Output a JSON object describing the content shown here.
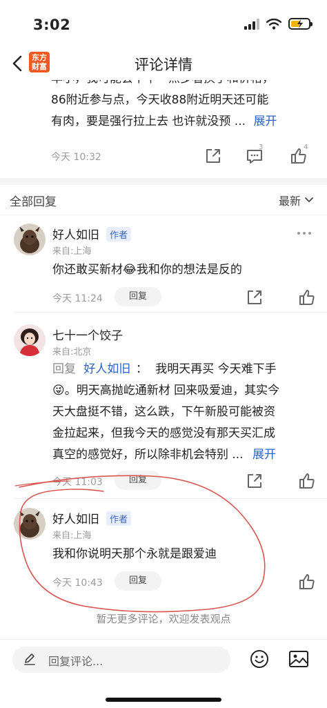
{
  "status_bar": {
    "time": "3:02"
  },
  "nav": {
    "title": "评论详情",
    "logo_line1": "东方",
    "logo_line2": "财富"
  },
  "main_comment": {
    "text_line1": "率小，我可能会下午一点多看换手和价格，",
    "text_line2": "86附近参与点，今天收88附近明天还可能",
    "text_line3": "有肉，要是强行拉上去 也许就没预 ...",
    "expand": "展开",
    "time": "今天 10:32",
    "comment_count": "3",
    "like_count": "4"
  },
  "replies_header": {
    "title": "全部回复",
    "sort": "最新"
  },
  "replies": [
    {
      "username": "好人如旧",
      "badge": "作者",
      "location": "来自:上海",
      "text": "你还敢买新材😂我和你的想法是反的",
      "time": "今天 11:24",
      "reply_label": "回复"
    },
    {
      "username": "七十一个饺子",
      "location": "来自:北京",
      "reply_prefix": "回复",
      "reply_to": "好人如旧",
      "reply_colon": "：",
      "text_line1": "我明天再买  今天难下手",
      "text_line2": "😜。明天高抛屹通新材 回来吸爱迪，其实今",
      "text_line3": "天大盘挺不错，这么跌，下午新股可能被资",
      "text_line4": "金拉起来，但我今天的感觉没有那天买汇成",
      "text_line5": "真空的感觉好，所以除非机会特别 ...",
      "expand": "展开",
      "time": "今天 11:03",
      "reply_label": "回复"
    },
    {
      "username": "好人如旧",
      "badge": "作者",
      "location": "来自:上海",
      "text": "我和你说明天那个永就是跟爱迪",
      "time": "今天 10:43",
      "reply_label": "回复"
    }
  ],
  "no_more_text": "暂无更多评论，欢迎发表观点",
  "bottom_bar": {
    "placeholder": "回复评论..."
  },
  "colors": {
    "accent_link": "#2b62c8",
    "brand": "#f05a22",
    "annotation": "#d9534f"
  }
}
